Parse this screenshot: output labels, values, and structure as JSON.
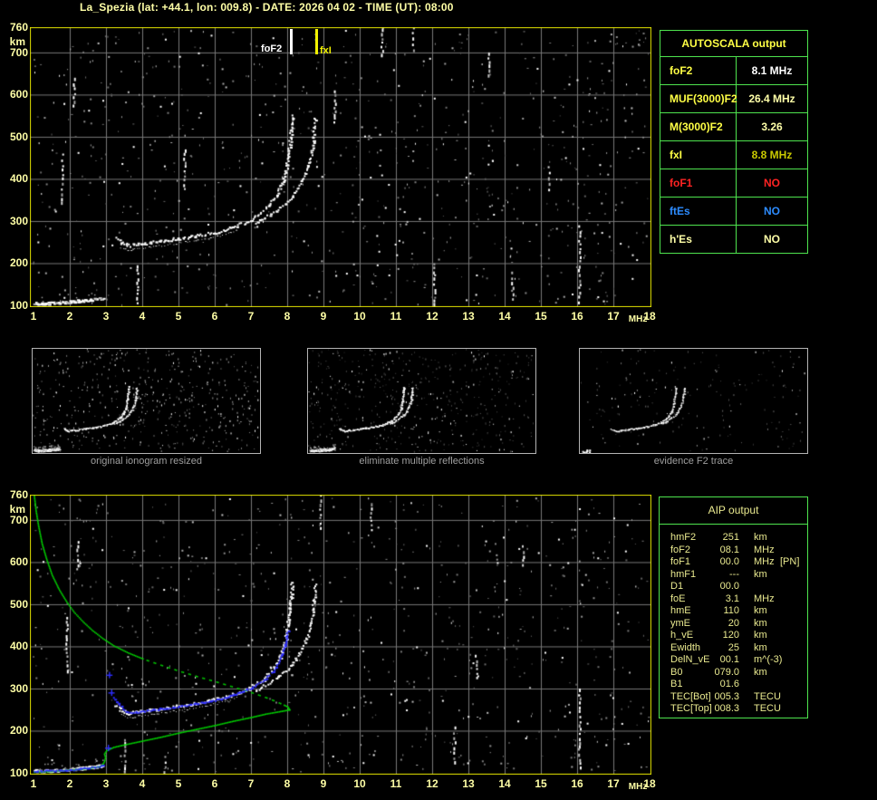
{
  "title": "La_Spezia (lat: +44.1, lon: 009.8) - DATE: 2026 04 02 - TIME (UT): 08:00",
  "colors": {
    "background": "#000000",
    "axis_text": "#ffffa6",
    "plot_border": "#e3e300",
    "grid": "#787878",
    "table_border": "#4ee44e",
    "caption_gray": "#9f9f9f",
    "aip_text": "#e9e98f",
    "green_profile": "#00d400",
    "blue_trace": "#2d2dff",
    "echo_white": "#ffffff",
    "fof2_marker": "#ffffff",
    "fxi_marker": "#f2f200"
  },
  "autoscala_table": {
    "title": "AUTOSCALA output",
    "rows": [
      {
        "label": "foF2",
        "value": "8.1 MHz",
        "label_color": "#ffff45",
        "value_color": "#ffffff"
      },
      {
        "label": "MUF(3000)F2",
        "value": "26.4 MHz",
        "label_color": "#ffff45",
        "value_color": "#ffffa8"
      },
      {
        "label": "M(3000)F2",
        "value": "3.26",
        "label_color": "#ffff45",
        "value_color": "#ffffa8"
      },
      {
        "label": "fxI",
        "value": "8.8 MHz",
        "label_color": "#ffff45",
        "value_color": "#c9c900"
      },
      {
        "label": "foF1",
        "value": "NO",
        "label_color": "#ff2323",
        "value_color": "#ff2323"
      },
      {
        "label": "ftEs",
        "value": "NO",
        "label_color": "#2d8cff",
        "value_color": "#2d8cff"
      },
      {
        "label": "h'Es",
        "value": "NO",
        "label_color": "#ffffa8",
        "value_color": "#ffffa8"
      }
    ]
  },
  "aip_table": {
    "title": "AIP output",
    "rows": [
      {
        "param": "hmF2",
        "value": "251",
        "unit": "km",
        "extra": ""
      },
      {
        "param": "foF2",
        "value": "08.1",
        "unit": "MHz",
        "extra": ""
      },
      {
        "param": "foF1",
        "value": "00.0",
        "unit": "MHz",
        "extra": "[PN]"
      },
      {
        "param": "hmF1",
        "value": "---",
        "unit": "km",
        "extra": ""
      },
      {
        "param": "D1",
        "value": "00.0",
        "unit": "",
        "extra": ""
      },
      {
        "param": "foE",
        "value": "3.1",
        "unit": "MHz",
        "extra": ""
      },
      {
        "param": "hmE",
        "value": "110",
        "unit": "km",
        "extra": ""
      },
      {
        "param": "ymE",
        "value": "20",
        "unit": "km",
        "extra": ""
      },
      {
        "param": "h_vE",
        "value": "120",
        "unit": "km",
        "extra": ""
      },
      {
        "param": "Ewidth",
        "value": "25",
        "unit": "km",
        "extra": ""
      },
      {
        "param": "DelN_vE",
        "value": "00.1",
        "unit": "m^(-3)",
        "extra": ""
      },
      {
        "param": "B0",
        "value": "079.0",
        "unit": "km",
        "extra": ""
      },
      {
        "param": "B1",
        "value": "01.6",
        "unit": "",
        "extra": ""
      },
      {
        "param": "TEC[Bot]",
        "value": "005.3",
        "unit": "TECU",
        "extra": ""
      },
      {
        "param": "TEC[Top]",
        "value": "008.3",
        "unit": "TECU",
        "extra": ""
      }
    ]
  },
  "panels": [
    {
      "caption": "original ionogram resized"
    },
    {
      "caption": "eliminate multiple reflections"
    },
    {
      "caption": "evidence F2 trace"
    }
  ],
  "chart_data": [
    {
      "type": "scatter",
      "title": "scaled ionogram",
      "xlabel": "MHz",
      "ylabel": "km",
      "xlim": [
        1,
        18
      ],
      "ylim": [
        100,
        768
      ],
      "x_ticks": [
        1,
        2,
        3,
        4,
        5,
        6,
        7,
        8,
        9,
        10,
        11,
        12,
        13,
        14,
        15,
        16,
        17,
        18
      ],
      "y_ticks": [
        760,
        700,
        600,
        500,
        400,
        300,
        200,
        100
      ],
      "grid": true,
      "markers": [
        {
          "label": "foF2",
          "freq_mhz": 8.1,
          "color": "#ffffff"
        },
        {
          "label": "fxI",
          "freq_mhz": 8.8,
          "color": "#f2f200"
        }
      ],
      "traces": {
        "e_echo": [
          [
            1.0,
            106
          ],
          [
            1.3,
            106
          ],
          [
            1.6,
            107
          ],
          [
            2.0,
            110
          ],
          [
            2.4,
            113
          ],
          [
            2.7,
            116
          ],
          [
            2.9,
            119
          ]
        ],
        "f2_ordinary": [
          [
            3.25,
            262
          ],
          [
            3.4,
            250
          ],
          [
            3.6,
            243
          ],
          [
            3.8,
            245
          ],
          [
            4.0,
            248
          ],
          [
            4.3,
            251
          ],
          [
            4.6,
            255
          ],
          [
            5.0,
            260
          ],
          [
            5.4,
            265
          ],
          [
            5.8,
            271
          ],
          [
            6.2,
            279
          ],
          [
            6.6,
            290
          ],
          [
            7.0,
            305
          ],
          [
            7.25,
            320
          ],
          [
            7.5,
            340
          ],
          [
            7.7,
            362
          ],
          [
            7.85,
            390
          ],
          [
            7.95,
            420
          ],
          [
            8.0,
            450
          ],
          [
            8.05,
            485
          ],
          [
            8.1,
            520
          ],
          [
            8.12,
            552
          ]
        ],
        "f2_extraordinary": [
          [
            7.1,
            295
          ],
          [
            7.4,
            310
          ],
          [
            7.7,
            327
          ],
          [
            8.0,
            348
          ],
          [
            8.2,
            368
          ],
          [
            8.4,
            395
          ],
          [
            8.55,
            425
          ],
          [
            8.65,
            458
          ],
          [
            8.7,
            490
          ],
          [
            8.73,
            520
          ],
          [
            8.75,
            548
          ]
        ]
      },
      "noise": {
        "seed": 11,
        "gray_dots": 720,
        "white_dots": 150,
        "streaks": [
          [
            1.78,
            460,
            55
          ],
          [
            3.85,
            195,
            80
          ],
          [
            10.6,
            765,
            35
          ],
          [
            11.45,
            762,
            30
          ],
          [
            13.55,
            700,
            25
          ],
          [
            16.05,
            290,
            85
          ],
          [
            12.05,
            200,
            60
          ],
          [
            9.3,
            610,
            40
          ],
          [
            15.2,
            430,
            25
          ],
          [
            5.15,
            470,
            45
          ],
          [
            2.1,
            640,
            30
          ],
          [
            14.2,
            180,
            30
          ]
        ]
      }
    },
    {
      "type": "scatter",
      "title": "ionogram with AIP electron density profile",
      "xlabel": "MHz",
      "ylabel": "km",
      "xlim": [
        1,
        18
      ],
      "ylim": [
        100,
        768
      ],
      "x_ticks": [
        1,
        2,
        3,
        4,
        5,
        6,
        7,
        8,
        9,
        10,
        11,
        12,
        13,
        14,
        15,
        16,
        17,
        18
      ],
      "y_ticks": [
        760,
        700,
        600,
        500,
        400,
        300,
        200,
        100
      ],
      "grid": true,
      "markers": [],
      "traces": {
        "e_echo": [
          [
            1.0,
            106
          ],
          [
            1.3,
            106
          ],
          [
            1.6,
            107
          ],
          [
            2.0,
            110
          ],
          [
            2.4,
            113
          ],
          [
            2.7,
            116
          ],
          [
            2.9,
            119
          ]
        ],
        "f2_ordinary": [
          [
            3.25,
            262
          ],
          [
            3.4,
            250
          ],
          [
            3.6,
            243
          ],
          [
            3.8,
            245
          ],
          [
            4.0,
            248
          ],
          [
            4.3,
            251
          ],
          [
            4.6,
            255
          ],
          [
            5.0,
            260
          ],
          [
            5.4,
            265
          ],
          [
            5.8,
            271
          ],
          [
            6.2,
            279
          ],
          [
            6.6,
            290
          ],
          [
            7.0,
            305
          ],
          [
            7.25,
            320
          ],
          [
            7.5,
            340
          ],
          [
            7.7,
            362
          ],
          [
            7.85,
            390
          ],
          [
            7.95,
            420
          ],
          [
            8.0,
            450
          ],
          [
            8.05,
            485
          ],
          [
            8.1,
            520
          ],
          [
            8.12,
            552
          ]
        ],
        "f2_extraordinary": [
          [
            7.1,
            295
          ],
          [
            7.4,
            310
          ],
          [
            7.7,
            327
          ],
          [
            8.0,
            348
          ],
          [
            8.2,
            368
          ],
          [
            8.4,
            395
          ],
          [
            8.55,
            425
          ],
          [
            8.65,
            458
          ],
          [
            8.7,
            490
          ],
          [
            8.73,
            520
          ],
          [
            8.75,
            548
          ]
        ],
        "profile_bottomside_green": [
          [
            1.0,
            103
          ],
          [
            1.5,
            105
          ],
          [
            2.0,
            108
          ],
          [
            2.5,
            112
          ],
          [
            2.8,
            116
          ],
          [
            2.88,
            120
          ],
          [
            2.94,
            128
          ],
          [
            2.97,
            138
          ],
          [
            2.94,
            146
          ],
          [
            3.0,
            154
          ],
          [
            3.2,
            162
          ],
          [
            3.5,
            168
          ],
          [
            4.0,
            177
          ],
          [
            4.5,
            186
          ],
          [
            5.0,
            196
          ],
          [
            5.5,
            205
          ],
          [
            6.0,
            214
          ],
          [
            6.5,
            224
          ],
          [
            7.0,
            233
          ],
          [
            7.4,
            241
          ],
          [
            7.8,
            247
          ],
          [
            8.05,
            251
          ]
        ],
        "profile_topside_green": [
          [
            8.05,
            251
          ],
          [
            8.0,
            258
          ],
          [
            7.8,
            266
          ],
          [
            7.5,
            277
          ],
          [
            7.0,
            292
          ],
          [
            6.5,
            305
          ],
          [
            6.0,
            318
          ],
          [
            5.5,
            330
          ],
          [
            5.0,
            343
          ],
          [
            4.5,
            357
          ],
          [
            4.0,
            372
          ],
          [
            3.6,
            386
          ],
          [
            3.2,
            403
          ],
          [
            2.9,
            420
          ],
          [
            2.6,
            440
          ],
          [
            2.35,
            460
          ],
          [
            2.1,
            483
          ],
          [
            1.9,
            507
          ],
          [
            1.7,
            535
          ],
          [
            1.5,
            570
          ],
          [
            1.35,
            607
          ],
          [
            1.22,
            645
          ],
          [
            1.12,
            688
          ],
          [
            1.05,
            725
          ],
          [
            1.0,
            762
          ]
        ],
        "topside_dotted_freq_range": [
          4.0,
          7.9
        ],
        "scaled_trace_blue": [
          [
            3.2,
            280
          ],
          [
            3.35,
            262
          ],
          [
            3.5,
            250
          ],
          [
            3.65,
            244
          ],
          [
            3.9,
            246
          ],
          [
            4.2,
            250
          ],
          [
            4.6,
            254
          ],
          [
            5.0,
            259
          ],
          [
            5.4,
            264
          ],
          [
            5.8,
            270
          ],
          [
            6.2,
            278
          ],
          [
            6.6,
            289
          ],
          [
            7.0,
            303
          ],
          [
            7.3,
            318
          ],
          [
            7.55,
            338
          ],
          [
            7.75,
            362
          ],
          [
            7.88,
            390
          ],
          [
            7.95,
            415
          ],
          [
            8.0,
            438
          ]
        ],
        "scaled_e_blue": [
          [
            1.0,
            106
          ],
          [
            1.4,
            106
          ],
          [
            1.8,
            107
          ],
          [
            2.2,
            110
          ],
          [
            2.5,
            113
          ],
          [
            2.75,
            116
          ],
          [
            2.9,
            120
          ]
        ],
        "blue_plus_points": [
          [
            3.08,
            333
          ],
          [
            3.14,
            291
          ],
          [
            3.05,
            160
          ]
        ]
      },
      "noise": {
        "seed": 29,
        "gray_dots": 680,
        "white_dots": 140,
        "streaks": [
          [
            1.9,
            470,
            60
          ],
          [
            3.5,
            180,
            60
          ],
          [
            10.3,
            740,
            30
          ],
          [
            16.05,
            300,
            90
          ],
          [
            12.6,
            210,
            40
          ],
          [
            8.9,
            760,
            40
          ],
          [
            14.5,
            640,
            25
          ],
          [
            2.2,
            650,
            30
          ],
          [
            4.6,
            140,
            40
          ],
          [
            13.2,
            380,
            25
          ]
        ]
      }
    }
  ]
}
